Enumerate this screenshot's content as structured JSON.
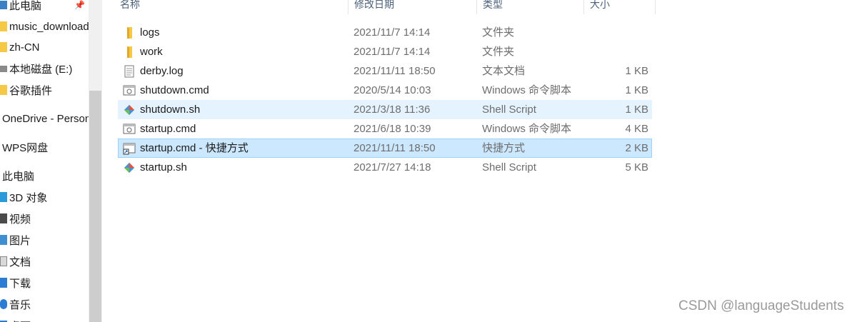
{
  "sidebar": {
    "items": [
      {
        "label": "此电脑",
        "icon": "pc-icon"
      },
      {
        "label": "music_download",
        "icon": "folder-icon"
      },
      {
        "label": "zh-CN",
        "icon": "folder-icon"
      },
      {
        "label": "本地磁盘 (E:)",
        "icon": "drive-icon"
      },
      {
        "label": "谷歌插件",
        "icon": "folder-icon"
      },
      {
        "label": "OneDrive - Personal",
        "icon": "onedrive-icon"
      },
      {
        "label": "WPS网盘",
        "icon": "cloud-icon"
      },
      {
        "label": "此电脑",
        "icon": "pc-icon"
      },
      {
        "label": "3D 对象",
        "icon": "3d-objects-icon"
      },
      {
        "label": "视频",
        "icon": "video-icon"
      },
      {
        "label": "图片",
        "icon": "pictures-icon"
      },
      {
        "label": "文档",
        "icon": "documents-icon"
      },
      {
        "label": "下载",
        "icon": "download-icon"
      },
      {
        "label": "音乐",
        "icon": "music-icon"
      },
      {
        "label": "桌面",
        "icon": "desktop-icon"
      }
    ]
  },
  "columns": {
    "name": "名称",
    "date": "修改日期",
    "type": "类型",
    "size": "大小"
  },
  "files": [
    {
      "name": "logs",
      "date": "2021/11/7 14:14",
      "type": "文件夹",
      "size": "",
      "icon": "folder-icon"
    },
    {
      "name": "work",
      "date": "2021/11/7 14:14",
      "type": "文件夹",
      "size": "",
      "icon": "folder-icon"
    },
    {
      "name": "derby.log",
      "date": "2021/11/11 18:50",
      "type": "文本文档",
      "size": "1 KB",
      "icon": "text-file-icon"
    },
    {
      "name": "shutdown.cmd",
      "date": "2020/5/14 10:03",
      "type": "Windows 命令脚本",
      "size": "1 KB",
      "icon": "cmd-file-icon"
    },
    {
      "name": "shutdown.sh",
      "date": "2021/3/18 11:36",
      "type": "Shell Script",
      "size": "1 KB",
      "icon": "git-shell-icon"
    },
    {
      "name": "startup.cmd",
      "date": "2021/6/18 10:39",
      "type": "Windows 命令脚本",
      "size": "4 KB",
      "icon": "cmd-file-icon"
    },
    {
      "name": "startup.cmd - 快捷方式",
      "date": "2021/11/11 18:50",
      "type": "快捷方式",
      "size": "2 KB",
      "icon": "shortcut-icon"
    },
    {
      "name": "startup.sh",
      "date": "2021/7/27 14:18",
      "type": "Shell Script",
      "size": "5 KB",
      "icon": "git-shell-icon"
    }
  ],
  "watermark": "CSDN @languageStudents",
  "colors": {
    "hover_row": "#e5f3ff",
    "selected_row": "#cce8ff",
    "folder": "#f5c846",
    "git_orange": "#f05133",
    "git_blue": "#4a90d9"
  }
}
